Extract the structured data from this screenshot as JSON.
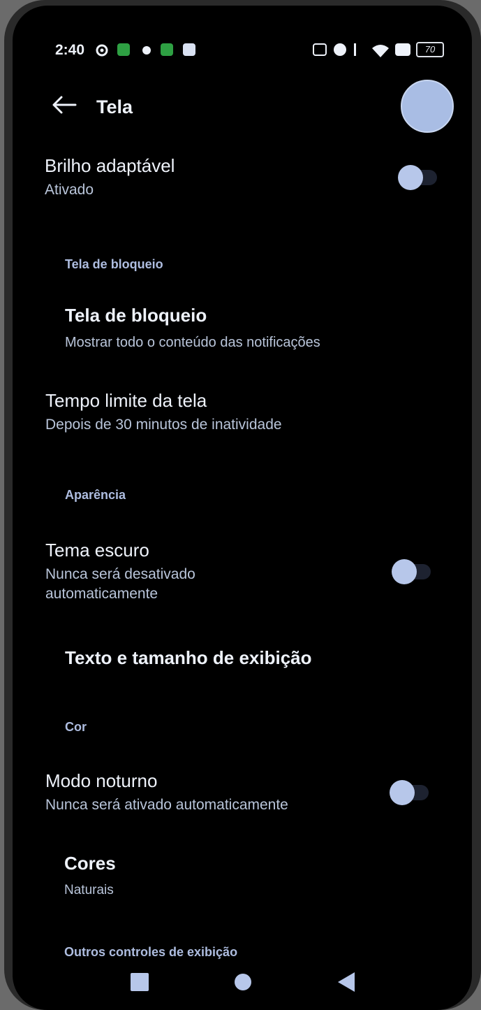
{
  "status_bar": {
    "time": "2:40",
    "battery": "70",
    "left_icons": [
      "settings-gear-icon",
      "app-grid-icon",
      "bug-icon",
      "sim-icon",
      "message-icon"
    ],
    "right_icons": [
      "nfc-icon",
      "alarm-icon",
      "bluetooth-icon",
      "wifi-icon",
      "screen-cast-icon",
      "battery-icon"
    ]
  },
  "header": {
    "title": "Tela"
  },
  "settings": {
    "adaptive_brightness": {
      "title": "Brilho adaptável",
      "subtitle": "Ativado",
      "enabled": false
    },
    "section_lock": "Tela de bloqueio",
    "lock_screen": {
      "title": "Tela de bloqueio",
      "subtitle": "Mostrar todo o conteúdo das notificações"
    },
    "screen_timeout": {
      "title": "Tempo limite da tela",
      "subtitle": "Depois de 30 minutos de inatividade"
    },
    "section_appearance": "Aparência",
    "dark_theme": {
      "title": "Tema escuro",
      "subtitle": "Nunca será desativado automaticamente",
      "enabled": false
    },
    "display_size": {
      "title": "Texto e tamanho de exibição"
    },
    "section_color": "Cor",
    "night_mode": {
      "title": "Modo noturno",
      "subtitle": "Nunca será ativado automaticamente",
      "enabled": false
    },
    "colors": {
      "title": "Cores",
      "subtitle": "Naturais"
    },
    "section_other": "Outros controles de exibição"
  },
  "nav_bar": {
    "icons": [
      "recents-square-icon",
      "home-circle-icon",
      "back-triangle-icon"
    ]
  },
  "colors": {
    "accent": "#b7c7ea",
    "background": "#000000"
  }
}
